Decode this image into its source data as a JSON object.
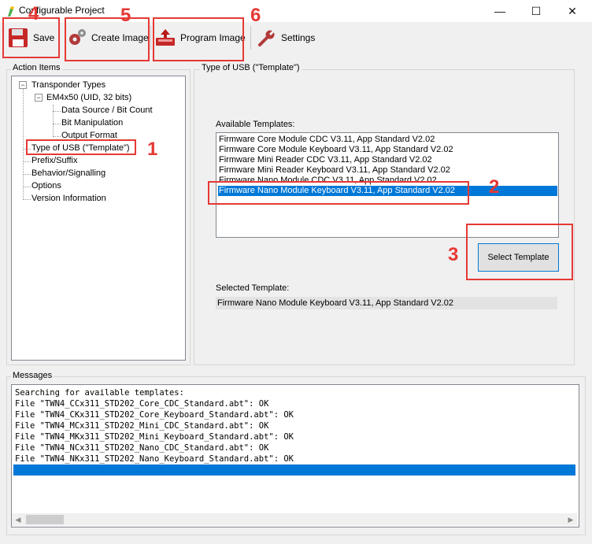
{
  "window": {
    "title": "Configurable Project",
    "controls": {
      "minimize": "—",
      "maximize": "☐",
      "close": "✕"
    }
  },
  "toolbar": {
    "save_label": "Save",
    "create_image_label": "Create Image",
    "program_image_label": "Program Image",
    "settings_label": "Settings",
    "icons": {
      "save": "floppy-disk-icon",
      "create_image": "gears-icon",
      "program_image": "chip-programmer-icon",
      "settings": "wrench-icon"
    }
  },
  "action_items": {
    "label": "Action Items",
    "tree": {
      "transponder_types": "Transponder Types",
      "em4x50": "EM4x50 (UID, 32 bits)",
      "data_source": "Data Source / Bit Count",
      "bit_manipulation": "Bit Manipulation",
      "output_format": "Output Format",
      "type_of_usb": "Type of USB (\"Template\")",
      "prefix_suffix": "Prefix/Suffix",
      "behavior": "Behavior/Signalling",
      "options": "Options",
      "version": "Version Information"
    }
  },
  "usb_panel": {
    "label": "Type of USB (\"Template\")",
    "available_label": "Available Templates:",
    "templates": [
      "Firmware Core Module CDC V3.11, App Standard V2.02",
      "Firmware Core Module Keyboard V3.11, App Standard V2.02",
      "Firmware Mini Reader CDC V3.11, App Standard V2.02",
      "Firmware Mini Reader Keyboard V3.11, App Standard V2.02",
      "Firmware Nano Module CDC V3.11, App Standard V2.02",
      "Firmware Nano Module Keyboard V3.11, App Standard V2.02"
    ],
    "selected_index": 5,
    "select_button": "Select Template",
    "selected_label": "Selected Template:",
    "selected_value": "Firmware Nano Module Keyboard V3.11, App Standard V2.02"
  },
  "messages": {
    "label": "Messages",
    "lines": [
      "Searching for available templates:",
      "File \"TWN4_CCx311_STD202_Core_CDC_Standard.abt\": OK",
      "File \"TWN4_CKx311_STD202_Core_Keyboard_Standard.abt\": OK",
      "File \"TWN4_MCx311_STD202_Mini_CDC_Standard.abt\": OK",
      "File \"TWN4_MKx311_STD202_Mini_Keyboard_Standard.abt\": OK",
      "File \"TWN4_NCx311_STD202_Nano_CDC_Standard.abt\": OK",
      "File \"TWN4_NKx311_STD202_Nano_Keyboard_Standard.abt\": OK"
    ]
  },
  "annotations": [
    "1",
    "2",
    "3",
    "4",
    "5",
    "6"
  ],
  "colors": {
    "accent": "#0078d7",
    "annotation": "#e53935"
  }
}
